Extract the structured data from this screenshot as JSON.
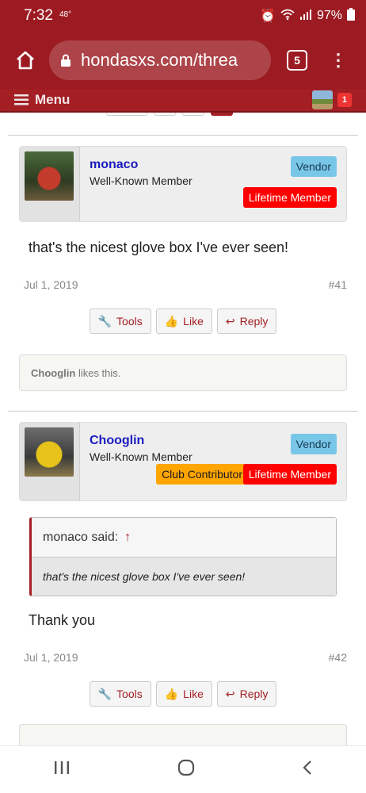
{
  "status": {
    "time": "7:32",
    "temp": "48°",
    "battery": "97%"
  },
  "browser": {
    "url": "hondasxs.com/threa",
    "tab_count": "5"
  },
  "forum_nav": {
    "menu_label": "Menu",
    "alert_count": "1"
  },
  "posts": [
    {
      "username": "monaco",
      "user_title": "Well-Known Member",
      "banners": {
        "vendor": "Vendor",
        "lifetime": "Lifetime Member"
      },
      "text": "that's the nicest glove box I've ever seen!",
      "date": "Jul 1, 2019",
      "number": "#41",
      "likes": {
        "user": "Chooglin",
        "suffix": " likes this."
      }
    },
    {
      "username": "Chooglin",
      "user_title": "Well-Known Member",
      "banners": {
        "vendor": "Vendor",
        "contributor": "Club Contributor",
        "lifetime": "Lifetime Member"
      },
      "quote": {
        "author": "monaco said:",
        "arrow": "↑",
        "text": "that's the nicest glove box I've ever seen!"
      },
      "text": "Thank you",
      "date": "Jul 1, 2019",
      "number": "#42"
    }
  ],
  "actions": {
    "tools": "Tools",
    "like": "Like",
    "reply": "Reply"
  },
  "colors": {
    "brand": "#9c1b22",
    "vendor": "#78c6e8",
    "lifetime": "#ff0000",
    "contributor": "#ffa500",
    "username": "#1a1abf"
  }
}
